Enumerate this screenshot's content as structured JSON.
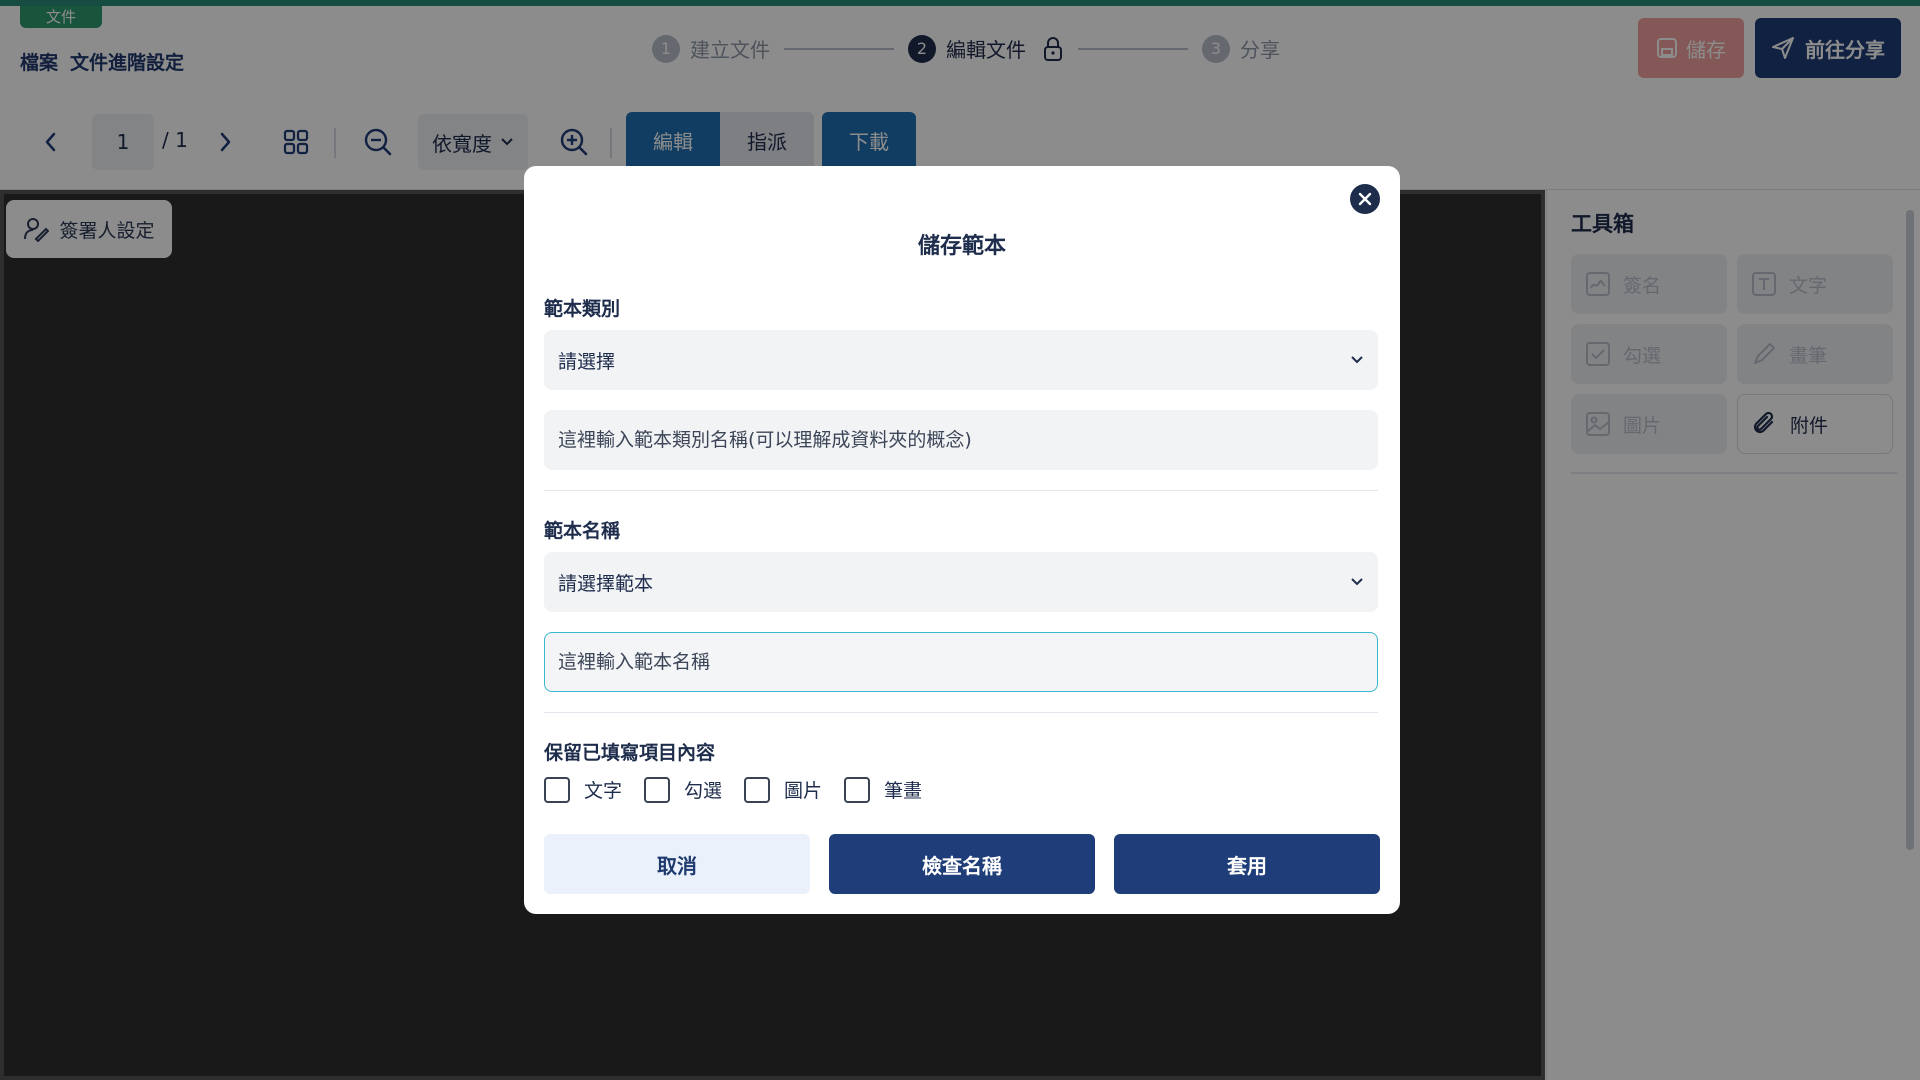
{
  "header": {
    "doc_tag": "文件",
    "crumb_parts": [
      "檔案",
      "文件進階設定"
    ],
    "steps": [
      {
        "num": "1",
        "label": "建立文件"
      },
      {
        "num": "2",
        "label": "編輯文件"
      },
      {
        "num": "3",
        "label": "分享"
      }
    ],
    "save_label": "儲存",
    "share_label": "前往分享"
  },
  "toolbar": {
    "page_current": "1",
    "page_total": "/ 1",
    "zoom_label": "依寬度",
    "tab_edit": "編輯",
    "tab_assign": "指派",
    "download": "下載"
  },
  "workspace": {
    "signer_settings": "簽署人設定"
  },
  "toolbox": {
    "title": "工具箱",
    "tools": [
      {
        "label": "簽名",
        "icon": "signature-icon",
        "enabled": false
      },
      {
        "label": "文字",
        "icon": "text-icon",
        "enabled": false
      },
      {
        "label": "勾選",
        "icon": "checkbox-icon",
        "enabled": false
      },
      {
        "label": "畫筆",
        "icon": "pen-icon",
        "enabled": false
      },
      {
        "label": "圖片",
        "icon": "image-icon",
        "enabled": false
      },
      {
        "label": "附件",
        "icon": "paperclip-icon",
        "enabled": true
      }
    ]
  },
  "modal": {
    "title": "儲存範本",
    "category_label": "範本類別",
    "category_select": "請選擇",
    "category_input_placeholder": "這裡輸入範本類別名稱(可以理解成資料夾的概念)",
    "name_label": "範本名稱",
    "name_select": "請選擇範本",
    "name_input_placeholder": "這裡輸入範本名稱",
    "keep_label": "保留已填寫項目內容",
    "keep_options": [
      "文字",
      "勾選",
      "圖片",
      "筆畫"
    ],
    "cancel": "取消",
    "check_name": "檢查名稱",
    "apply": "套用"
  },
  "colors": {
    "primary": "#1f3d78",
    "accent_focus": "#3cb6cf",
    "tab_blue": "#1f6fb2",
    "doc_green": "#2f9a70"
  }
}
